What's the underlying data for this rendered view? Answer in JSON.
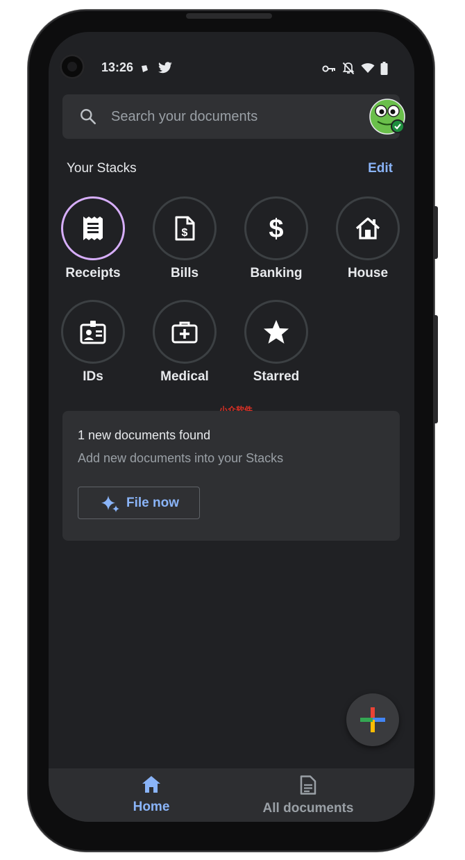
{
  "status_bar": {
    "time": "13:26",
    "left_icons": [
      "notification-dot-icon",
      "twitter-icon"
    ],
    "right_icons": [
      "vpn-key-icon",
      "notifications-off-icon",
      "wifi-icon",
      "battery-icon"
    ]
  },
  "search": {
    "placeholder": "Search your documents",
    "avatar_icon": "frog-avatar-icon"
  },
  "stacks": {
    "title": "Your Stacks",
    "edit_label": "Edit",
    "items": [
      {
        "label": "Receipts",
        "icon": "receipt-icon",
        "selected": true
      },
      {
        "label": "Bills",
        "icon": "bill-icon",
        "selected": false
      },
      {
        "label": "Banking",
        "icon": "dollar-icon",
        "selected": false
      },
      {
        "label": "House",
        "icon": "house-icon",
        "selected": false
      },
      {
        "label": "IDs",
        "icon": "id-card-icon",
        "selected": false
      },
      {
        "label": "Medical",
        "icon": "medical-kit-icon",
        "selected": false
      },
      {
        "label": "Starred",
        "icon": "star-icon",
        "selected": false
      }
    ]
  },
  "watermark": "小众软件",
  "card": {
    "title": "1 new documents found",
    "subtitle": "Add new documents into your Stacks",
    "button_label": "File now",
    "button_icon": "sparkle-icon"
  },
  "fab": {
    "icon": "plus-icon"
  },
  "bottom_nav": {
    "items": [
      {
        "label": "Home",
        "icon": "home-icon",
        "active": true
      },
      {
        "label": "All documents",
        "icon": "document-icon",
        "active": false
      }
    ]
  },
  "colors": {
    "background": "#202124",
    "surface": "#303134",
    "accent": "#8ab4f8",
    "selected_ring": "#d7aefb",
    "text": "#e8eaed",
    "muted": "#9aa0a6"
  }
}
